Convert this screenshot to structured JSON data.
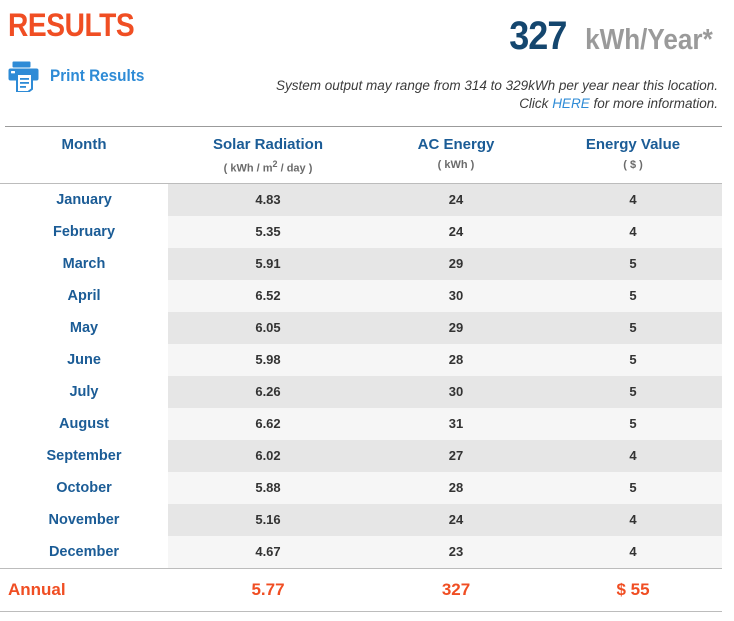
{
  "header": {
    "title": "RESULTS",
    "print_label": "Print Results",
    "print_icon": "printer-icon",
    "annual_total": "327",
    "annual_unit": "kWh/Year*",
    "note_line1": "System output may range from 314 to 329kWh per year near this location.",
    "note_click_prefix": "Click ",
    "note_link": "HERE",
    "note_click_suffix": " for more information."
  },
  "colors": {
    "accent_orange": "#F04E23",
    "link_blue": "#2E8BD6",
    "header_blue": "#1B5C96",
    "navy": "#14466E",
    "unit_gray": "#9A9A9A",
    "row_shade": "#e6e6e6",
    "row_plain": "#f6f6f6"
  },
  "table": {
    "columns": [
      {
        "title": "Month",
        "units": ""
      },
      {
        "title": "Solar Radiation",
        "units_pre": "( kWh / m",
        "units_sup": "2",
        "units_post": " / day )"
      },
      {
        "title": "AC Energy",
        "units": "( kWh )"
      },
      {
        "title": "Energy Value",
        "units": "( $ )"
      }
    ],
    "rows": [
      {
        "month": "January",
        "solar": "4.83",
        "ac": "24",
        "value": "4"
      },
      {
        "month": "February",
        "solar": "5.35",
        "ac": "24",
        "value": "4"
      },
      {
        "month": "March",
        "solar": "5.91",
        "ac": "29",
        "value": "5"
      },
      {
        "month": "April",
        "solar": "6.52",
        "ac": "30",
        "value": "5"
      },
      {
        "month": "May",
        "solar": "6.05",
        "ac": "29",
        "value": "5"
      },
      {
        "month": "June",
        "solar": "5.98",
        "ac": "28",
        "value": "5"
      },
      {
        "month": "July",
        "solar": "6.26",
        "ac": "30",
        "value": "5"
      },
      {
        "month": "August",
        "solar": "6.62",
        "ac": "31",
        "value": "5"
      },
      {
        "month": "September",
        "solar": "6.02",
        "ac": "27",
        "value": "4"
      },
      {
        "month": "October",
        "solar": "5.88",
        "ac": "28",
        "value": "5"
      },
      {
        "month": "November",
        "solar": "5.16",
        "ac": "24",
        "value": "4"
      },
      {
        "month": "December",
        "solar": "4.67",
        "ac": "23",
        "value": "4"
      }
    ],
    "footer": {
      "label": "Annual",
      "solar": "5.77",
      "ac": "327",
      "value": "$ 55"
    }
  }
}
